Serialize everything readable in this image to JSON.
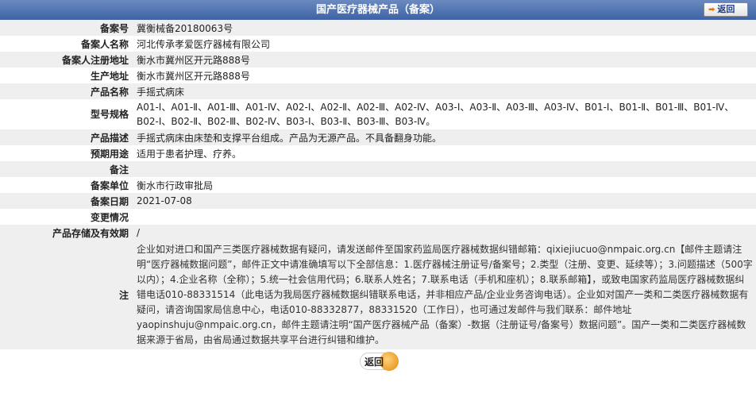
{
  "header": {
    "title": "国产医疗器械产品（备案）",
    "back_label": "返回"
  },
  "rows": [
    {
      "label": "备案号",
      "value": "冀衡械备20180063号"
    },
    {
      "label": "备案人名称",
      "value": "河北传承孝爱医疗器械有限公司"
    },
    {
      "label": "备案人注册地址",
      "value": "衡水市冀州区开元路888号"
    },
    {
      "label": "生产地址",
      "value": "衡水市冀州区开元路888号"
    },
    {
      "label": "产品名称",
      "value": "手摇式病床"
    },
    {
      "label": "型号规格",
      "value": "A01-Ⅰ、A01-Ⅱ、A01-Ⅲ、A01-Ⅳ、A02-Ⅰ、A02-Ⅱ、A02-Ⅲ、A02-Ⅳ、A03-Ⅰ、A03-Ⅱ、A03-Ⅲ、A03-Ⅳ、B01-Ⅰ、B01-Ⅱ、B01-Ⅲ、B01-Ⅳ、B02-Ⅰ、B02-Ⅱ、B02-Ⅲ、B02-Ⅳ、B03-Ⅰ、B03-Ⅱ、B03-Ⅲ、B03-Ⅳ。"
    },
    {
      "label": "产品描述",
      "value": "手摇式病床由床垫和支撑平台组成。产品为无源产品。不具备翻身功能。"
    },
    {
      "label": "预期用途",
      "value": "适用于患者护理、疗养。"
    },
    {
      "label": "备注",
      "value": ""
    },
    {
      "label": "备案单位",
      "value": "衡水市行政审批局"
    },
    {
      "label": "备案日期",
      "value": "2021-07-08"
    },
    {
      "label": "变更情况",
      "value": ""
    },
    {
      "label": "产品存储及有效期",
      "value": "/"
    }
  ],
  "note": {
    "label": "注",
    "text": "企业如对进口和国产三类医疗器械数据有疑问，请发送邮件至国家药监局医疗器械数据纠错邮箱：qixiejiucuo@nmpaic.org.cn【邮件主题请注明“医疗器械数据问题”，邮件正文中请准确填写以下全部信息：1.医疗器械注册证号/备案号；2.类型（注册、变更、延续等）；3.问题描述（500字以内）；4.企业名称（全称）；5.统一社会信用代码；6.联系人姓名；7.联系电话（手机和座机）；8.联系邮箱】，或致电国家药监局医疗器械数据纠错电话010-88331514（此电话为我局医疗器械数据纠错联系电话，并非相应产品/企业业务咨询电话）。企业如对国产一类和二类医疗器械数据有疑问，请咨询国家局信息中心，电话010-88332877，88331520（工作日），也可通过发邮件与我们联系：邮件地址yaopinshuju@nmpaic.org.cn，邮件主题请注明“国产医疗器械产品（备案）-数据（注册证号/备案号）数据问题”。国产一类和二类医疗器械数据来源于省局，由省局通过数据共享平台进行纠错和维护。"
  },
  "footer": {
    "back_label": "返回"
  }
}
